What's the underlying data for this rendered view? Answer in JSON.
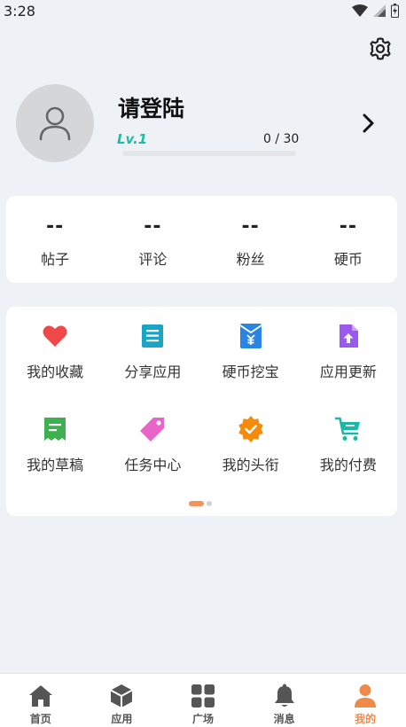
{
  "status_bar": {
    "time": "3:28"
  },
  "profile": {
    "username": "请登陆",
    "level": "Lv.1",
    "exp_text": "0 / 30",
    "exp_progress": 0
  },
  "stats": [
    {
      "value": "--",
      "label": "帖子"
    },
    {
      "value": "--",
      "label": "评论"
    },
    {
      "value": "--",
      "label": "粉丝"
    },
    {
      "value": "--",
      "label": "硬币"
    }
  ],
  "menu": [
    {
      "label": "我的收藏",
      "icon": "heart-icon",
      "color": "#f04848"
    },
    {
      "label": "分享应用",
      "icon": "document-icon",
      "color": "#1aa5c7"
    },
    {
      "label": "硬币挖宝",
      "icon": "coin-envelope-icon",
      "color": "#2a84e2"
    },
    {
      "label": "应用更新",
      "icon": "upload-file-icon",
      "color": "#9b59f0"
    },
    {
      "label": "我的草稿",
      "icon": "draft-icon",
      "color": "#3fb050"
    },
    {
      "label": "任务中心",
      "icon": "tag-icon",
      "color": "#e964c9"
    },
    {
      "label": "我的头衔",
      "icon": "badge-icon",
      "color": "#f58a0b"
    },
    {
      "label": "我的付费",
      "icon": "cart-icon",
      "color": "#19b9a5"
    }
  ],
  "tabs": [
    {
      "label": "首页",
      "icon": "home-icon",
      "active": false
    },
    {
      "label": "应用",
      "icon": "cube-icon",
      "active": false
    },
    {
      "label": "广场",
      "icon": "grid-icon",
      "active": false
    },
    {
      "label": "消息",
      "icon": "bell-icon",
      "active": false
    },
    {
      "label": "我的",
      "icon": "person-icon",
      "active": true
    }
  ],
  "colors": {
    "accent": "#f08a4b",
    "level": "#1bbfa3",
    "inactive_tab": "#555555"
  }
}
